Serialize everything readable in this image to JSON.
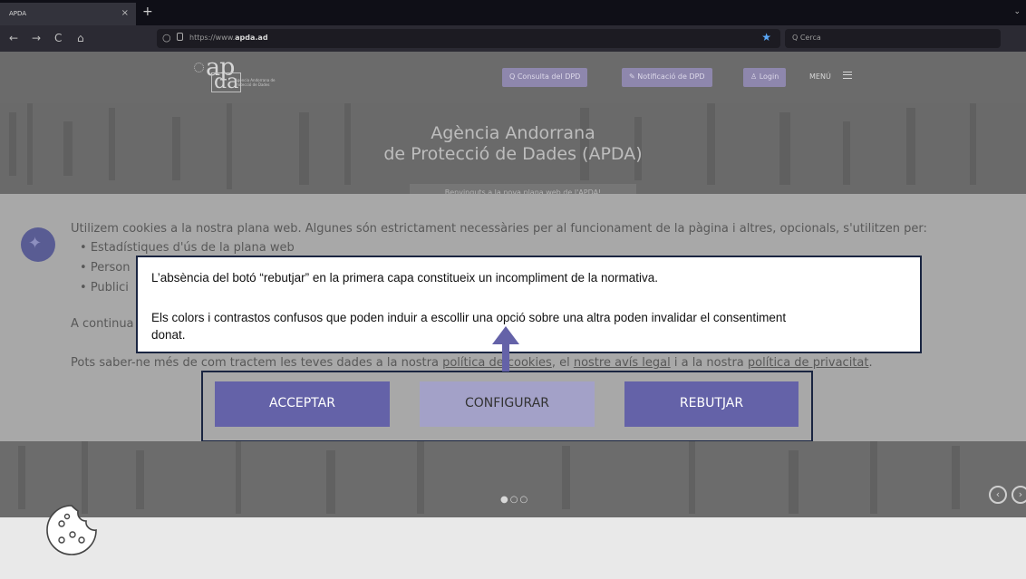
{
  "browser": {
    "tab_title": "APDA",
    "tab_close": "×",
    "new_tab": "+",
    "nav_back": "←",
    "nav_forward": "→",
    "nav_reload": "C",
    "nav_home": "⌂",
    "url_prefix": "https://www.",
    "url_domain": "apda.ad",
    "search_placeholder": "Q Cerca"
  },
  "header": {
    "logo_ap": "ap",
    "logo_da": "da",
    "logo_subtitle": "Agència Andorrana de Protecció de Dades",
    "buttons": [
      {
        "label": "Q  Consulta del DPD"
      },
      {
        "label": "✎  Notificació de DPD"
      },
      {
        "label": "♙  Login"
      }
    ],
    "menu_label": "MENÚ"
  },
  "hero": {
    "title_line1": "Agència Andorrana",
    "title_line2": "de Protecció de Dades (APDA)",
    "subtitle": "Benvinguts a la nova plana web de l'APDA!"
  },
  "cookies": {
    "intro": "Utilizem cookies a la nostra plana web. Algunes són estrictament necessàries per al funcionament de la pàgina i altres, opcionals, s'utilitzen  per:",
    "bullets": [
      "Estadístiques d'ús de la plana web",
      "Person",
      "Publici"
    ],
    "continua": "A continua",
    "more_prefix": "Pots saber-ne més de com tractem les teves dades a la nostra ",
    "link_cookies": "política de cookies",
    "more_mid1": ", el ",
    "link_legal": "nostre avís legal",
    "more_mid2": " i a la nostra ",
    "link_privacy": "política de privacitat",
    "more_end": ".",
    "accept_label": "ACCEPTAR",
    "configure_label": "CONFIGURAR",
    "reject_label": "REBUTJAR"
  },
  "annotation": {
    "line1": "L’absència del botó “rebutjar” en la primera capa constitueix un incompliment de la normativa.",
    "line2": "Els colors i contrastos confusos que poden induir a escollir una opció sobre una altra poden invalidar el consentiment",
    "line3": "donat."
  },
  "carousel": {
    "dots": "●○○",
    "prev": "‹",
    "next": "›"
  },
  "colors": {
    "accept_bg": "#6462a8",
    "configure_bg": "#a3a1c8",
    "reject_bg": "#6462a8",
    "annotation_border": "#1a2541"
  }
}
